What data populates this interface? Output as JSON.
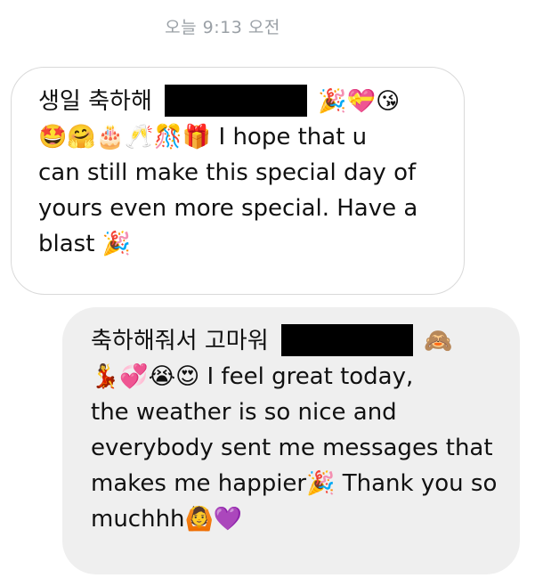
{
  "timestamp": "오늘 9:13 오전",
  "received_message": {
    "line1_text": "생일 축하해",
    "line1_emoji": "🎉💝😘",
    "line2_emoji": "🤩🤗🎂🥂🎊🎁",
    "line2_text": " I hope that u",
    "line3": "can still make this special day of",
    "line4": "yours even more special. Have a",
    "line5_text": "blast ",
    "line5_emoji": "🎉"
  },
  "sent_message": {
    "line1_text": "축하해줘서 고마워",
    "line1_emoji": "🙈",
    "line2_emoji": "💃💞😭😍",
    "line2_text": " I feel great today,",
    "line3": "the weather is so nice and",
    "line4": "everybody sent me messages that",
    "line5_text": "makes me happier",
    "line5_emoji": "🎉",
    "line5_text2": " Thank you so",
    "line6_text": "muchhh",
    "line6_emoji": "🙆💜"
  }
}
